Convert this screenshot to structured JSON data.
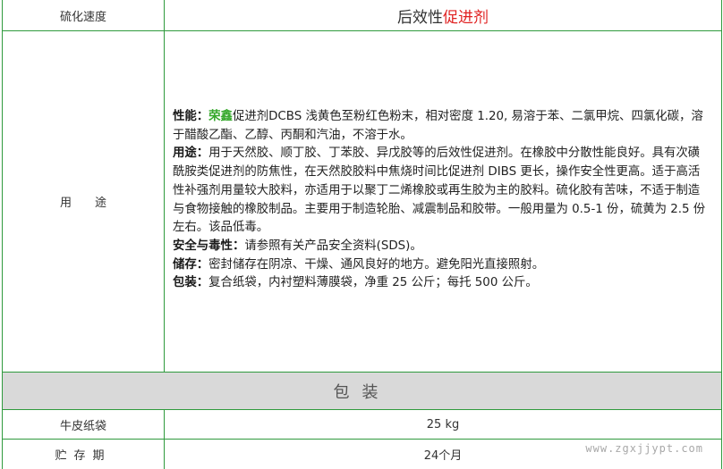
{
  "rows": {
    "speed_label": "硫化速度",
    "speed_value_prefix": "后效性",
    "speed_value_accent": "促进剂",
    "usage_label": "用　　途",
    "section_title": "包装",
    "bag_label": "牛皮纸袋",
    "bag_value": "25 kg",
    "storage_label": "贮存期",
    "storage_value": "24个月"
  },
  "usage": {
    "perf_label": "性能：",
    "brand": "荣鑫",
    "perf_text": "促进剂DCBS 浅黄色至粉红色粉末，相对密度 1.20, 易溶于苯、二氯甲烷、四氯化碳，溶于醋酸乙酯、乙醇、丙酮和汽油，不溶于水。",
    "use_label": "用途：",
    "use_text": "用于天然胶、顺丁胶、丁苯胶、异戊胶等的后效性促进剂。在橡胶中分散性能良好。具有次磺酰胺类促进剂的防焦性，在天然胶胶料中焦烧时间比促进剂 DIBS 更长，操作安全性更高。适于高活性补强剂用量较大胶料，亦适用于以聚丁二烯橡胶或再生胶为主的胶料。硫化胶有苦味，不适于制造与食物接触的橡胶制品。主要用于制造轮胎、减震制品和胶带。一般用量为 0.5-1 份，硫黄为 2.5 份左右。该品低毒。",
    "safety_label": "安全与毒性：",
    "safety_text": "请参照有关产品安全资料(SDS)。",
    "storage_label": "储存：",
    "storage_text": "密封储存在阴凉、干燥、通风良好的地方。避免阳光直接照射。",
    "pack_label": "包装：",
    "pack_text": "复合纸袋，内衬塑料薄膜袋，净重 25 公斤；每托 500 公斤。"
  },
  "watermark": "www.zgxjjypt.com",
  "colors": {
    "border": "#2f9a3d",
    "accent_red": "#e02020",
    "brand_green": "#35a82b",
    "section_bg": "#d9d9d9"
  }
}
